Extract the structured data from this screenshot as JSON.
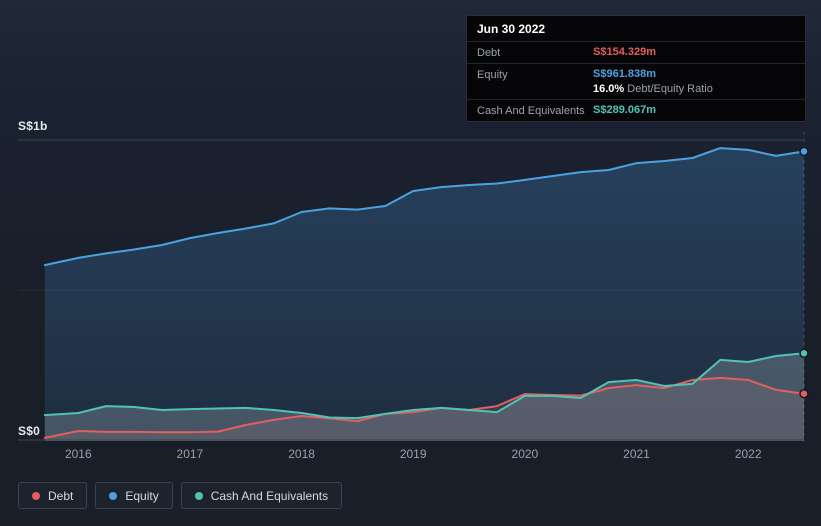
{
  "palette": {
    "debt": "#e25f5f",
    "equity": "#4aa3e0",
    "cash": "#4fc4b4"
  },
  "axis": {
    "y_top": "S$1b",
    "y_bottom": "S$0",
    "x_ticks": [
      "2016",
      "2017",
      "2018",
      "2019",
      "2020",
      "2021",
      "2022"
    ]
  },
  "tooltip": {
    "date": "Jun 30 2022",
    "debt_label": "Debt",
    "debt_value": "S$154.329m",
    "equity_label": "Equity",
    "equity_value": "S$961.838m",
    "ratio_value": "16.0%",
    "ratio_label": "Debt/Equity Ratio",
    "cash_label": "Cash And Equivalents",
    "cash_value": "S$289.067m"
  },
  "legend": {
    "debt": {
      "label": "Debt"
    },
    "equity": {
      "label": "Equity"
    },
    "cash": {
      "label": "Cash And Equivalents"
    }
  },
  "chart_data": {
    "type": "area",
    "ylim": [
      0,
      1000
    ],
    "x_range": [
      2015.7,
      2022.5
    ],
    "y_gridlines": [
      1000,
      500,
      0
    ],
    "y_gridline_labels": [
      "S$1b",
      "",
      "S$0"
    ],
    "x": [
      2015.7,
      2016.0,
      2016.25,
      2016.5,
      2016.75,
      2017.0,
      2017.25,
      2017.5,
      2017.75,
      2018.0,
      2018.25,
      2018.5,
      2018.75,
      2019.0,
      2019.25,
      2019.5,
      2019.75,
      2020.0,
      2020.25,
      2020.5,
      2020.75,
      2021.0,
      2021.25,
      2021.5,
      2021.75,
      2022.0,
      2022.25,
      2022.5
    ],
    "series": [
      {
        "name": "Equity",
        "color": "#4aa3e0",
        "fill_top": "#27425f",
        "fill_bottom": "#202f42",
        "values": [
          583,
          607,
          622,
          635,
          650,
          673,
          690,
          705,
          722,
          760,
          772,
          768,
          780,
          830,
          843,
          850,
          855,
          867,
          880,
          893,
          900,
          923,
          930,
          940,
          973,
          967,
          947,
          961.838
        ]
      },
      {
        "name": "Debt",
        "color": "#e25f5f",
        "fill": "rgba(214,122,122,0.14)",
        "values": [
          7,
          30,
          27,
          27,
          26,
          26,
          28,
          50,
          67,
          80,
          72,
          63,
          87,
          93,
          107,
          100,
          113,
          153,
          150,
          148,
          173,
          183,
          173,
          200,
          207,
          200,
          167,
          154.329
        ]
      },
      {
        "name": "Cash And Equivalents",
        "color": "#4fc4b4",
        "fill": "rgba(158,175,182,0.30)",
        "values": [
          83,
          90,
          113,
          110,
          100,
          103,
          105,
          107,
          100,
          90,
          75,
          73,
          87,
          100,
          107,
          100,
          93,
          147,
          147,
          140,
          193,
          200,
          180,
          187,
          267,
          260,
          280,
          289.067
        ]
      }
    ]
  }
}
